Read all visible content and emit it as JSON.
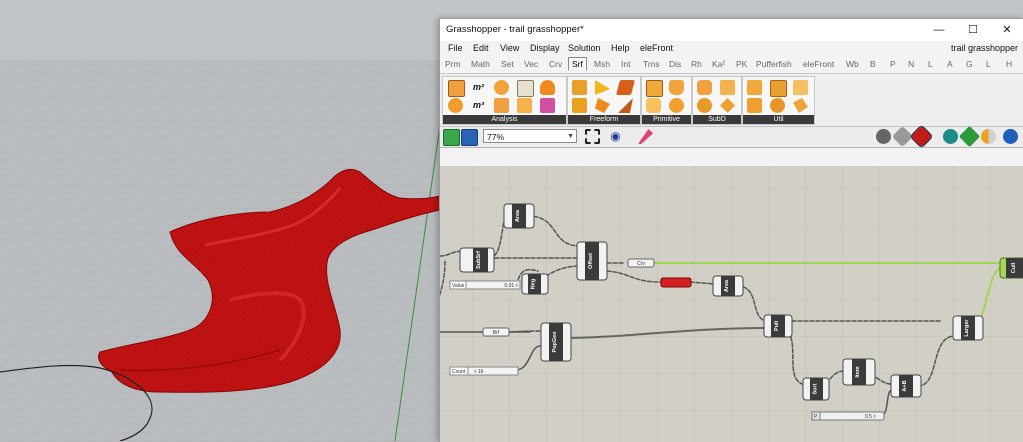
{
  "window": {
    "title": "Grasshopper - trail grasshopper*",
    "minimize_label": "—",
    "maximize_label": "☐",
    "close_label": "✕"
  },
  "menu": {
    "items": [
      "File",
      "Edit",
      "View",
      "Display",
      "Solution",
      "Help",
      "eleFront"
    ],
    "document_name": "trail grasshopper"
  },
  "tabs": {
    "items": [
      "Prm",
      "Math",
      "Set",
      "Vec",
      "Crv",
      "Srf",
      "Msh",
      "Int",
      "Trns",
      "Dis",
      "Rh",
      "Ka²",
      "PK",
      "Pufferfish",
      "eleFront",
      "Wb",
      "B",
      "P",
      "N",
      "L",
      "A",
      "G",
      "L",
      "H"
    ],
    "active": "Srf"
  },
  "ribbon": {
    "panels": [
      "Analysis",
      "Freeform",
      "Primitive",
      "SubD",
      "Util"
    ],
    "analysis_icon_texts": [
      "m²",
      "m³"
    ]
  },
  "toolbar": {
    "zoom": "77%"
  },
  "canvas": {
    "components": {
      "area_top": "Area",
      "subsrf": "SubSrf",
      "offset": "Offset",
      "neg": "Neg",
      "area_mid": "Area",
      "pull": "Pull",
      "popgeo": "PopGeo",
      "sort": "Sort",
      "item": "Item",
      "a_plus_b": "A+B",
      "larger": "Larger",
      "cull": "Cull"
    },
    "panels": {
      "value_label": "Value",
      "value_text": "0.01 ◊",
      "count_label": "Count",
      "count_text": "◊ 16",
      "slider_label": "P",
      "slider_value": "0.5 ◊",
      "crv_label": "Crv",
      "brf_label": "Brf"
    }
  },
  "colors": {
    "surface_red": "#d01818",
    "wire_green": "#9ed64a",
    "component_dark": "#3b3b3b",
    "canvas_bg": "#d1cfc6",
    "error_red": "#d42020"
  }
}
